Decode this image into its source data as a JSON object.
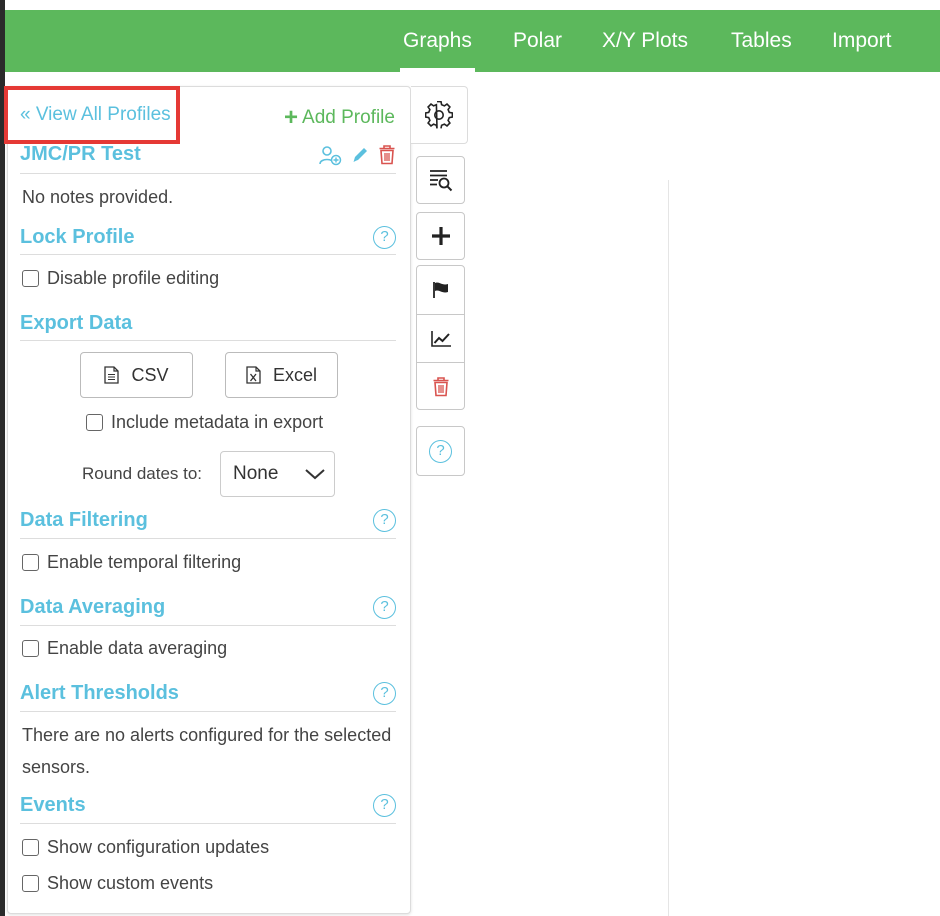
{
  "nav": {
    "tabs": [
      {
        "label": "Graphs",
        "active": true
      },
      {
        "label": "Polar"
      },
      {
        "label": "X/Y Plots"
      },
      {
        "label": "Tables"
      },
      {
        "label": "Import"
      }
    ]
  },
  "profile": {
    "back_link": "« View All Profiles",
    "add_profile": "Add Profile",
    "name": "JMC/PR Test",
    "notes": "No notes provided."
  },
  "lock": {
    "title": "Lock Profile",
    "disable_editing": "Disable profile editing"
  },
  "export": {
    "title": "Export Data",
    "csv_label": "CSV",
    "excel_label": "Excel",
    "include_metadata": "Include metadata in export",
    "round_dates_label": "Round dates to:",
    "round_dates_value": "None"
  },
  "filtering": {
    "title": "Data Filtering",
    "enable": "Enable temporal filtering"
  },
  "averaging": {
    "title": "Data Averaging",
    "enable": "Enable data averaging"
  },
  "alerts": {
    "title": "Alert Thresholds",
    "message_line1": "There are no alerts configured for the selected",
    "message_line2": "sensors."
  },
  "events": {
    "title": "Events",
    "show_config": "Show configuration updates",
    "show_custom": "Show custom events"
  },
  "help_glyph": "?",
  "colors": {
    "nav_green": "#5cb85c",
    "section_blue": "#5bc0de",
    "add_green": "#5cb85c",
    "danger_red": "#d9534f",
    "highlight_red": "#e53935"
  },
  "icons": [
    "gear-icon",
    "list-search-icon",
    "plus-icon",
    "flag-icon",
    "line-chart-icon",
    "trash-icon",
    "help-icon",
    "user-share-icon",
    "pencil-icon",
    "document-icon",
    "excel-icon",
    "chevron-down-icon"
  ]
}
